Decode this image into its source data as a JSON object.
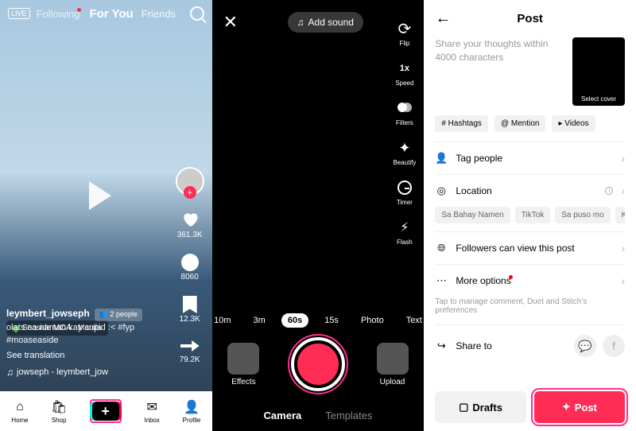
{
  "feed": {
    "live_badge": "LIVE",
    "tabs": {
      "following": "Following",
      "foryou": "For You",
      "friends": "Friends"
    },
    "location": "Seaside MOA · Manila",
    "username": "leymbert_jowseph",
    "people_button": "👥 2 people",
    "caption": "olats na naman kay cupid :<  #fyp #moaseaside",
    "see_translation": "See translation",
    "music": "jowseph - leymbert_jow",
    "rail": {
      "likes": "361.3K",
      "comments": "8060",
      "saves": "12.3K",
      "shares": "79.2K"
    },
    "bottom": {
      "home": "Home",
      "shop": "Shop",
      "inbox": "Inbox",
      "profile": "Profile"
    }
  },
  "camera": {
    "add_sound": "Add sound",
    "tools": {
      "flip": "Flip",
      "speed": "Speed",
      "filters": "Filters",
      "beautify": "Beautify",
      "timer": "Timer",
      "flash": "Flash"
    },
    "durations": [
      "10m",
      "3m",
      "60s",
      "15s",
      "Photo",
      "Text"
    ],
    "effects": "Effects",
    "upload": "Upload",
    "tabs": {
      "camera": "Camera",
      "templates": "Templates"
    }
  },
  "post": {
    "title": "Post",
    "placeholder": "Share your thoughts within 4000 characters",
    "cover": "Select cover",
    "chips": {
      "hashtags": "# Hashtags",
      "mention": "@ Mention",
      "videos": "▸ Videos"
    },
    "tag_people": "Tag people",
    "location": "Location",
    "loc_suggestions": [
      "Sa Bahay Namen",
      "TikTok",
      "Sa puso mo",
      "KAHIT SA"
    ],
    "visibility": "Followers can view this post",
    "more_options": "More options",
    "more_sub": "Tap to manage comment, Duet and Stitch's preferences",
    "share_to": "Share to",
    "drafts": "Drafts",
    "post_btn": "Post"
  }
}
